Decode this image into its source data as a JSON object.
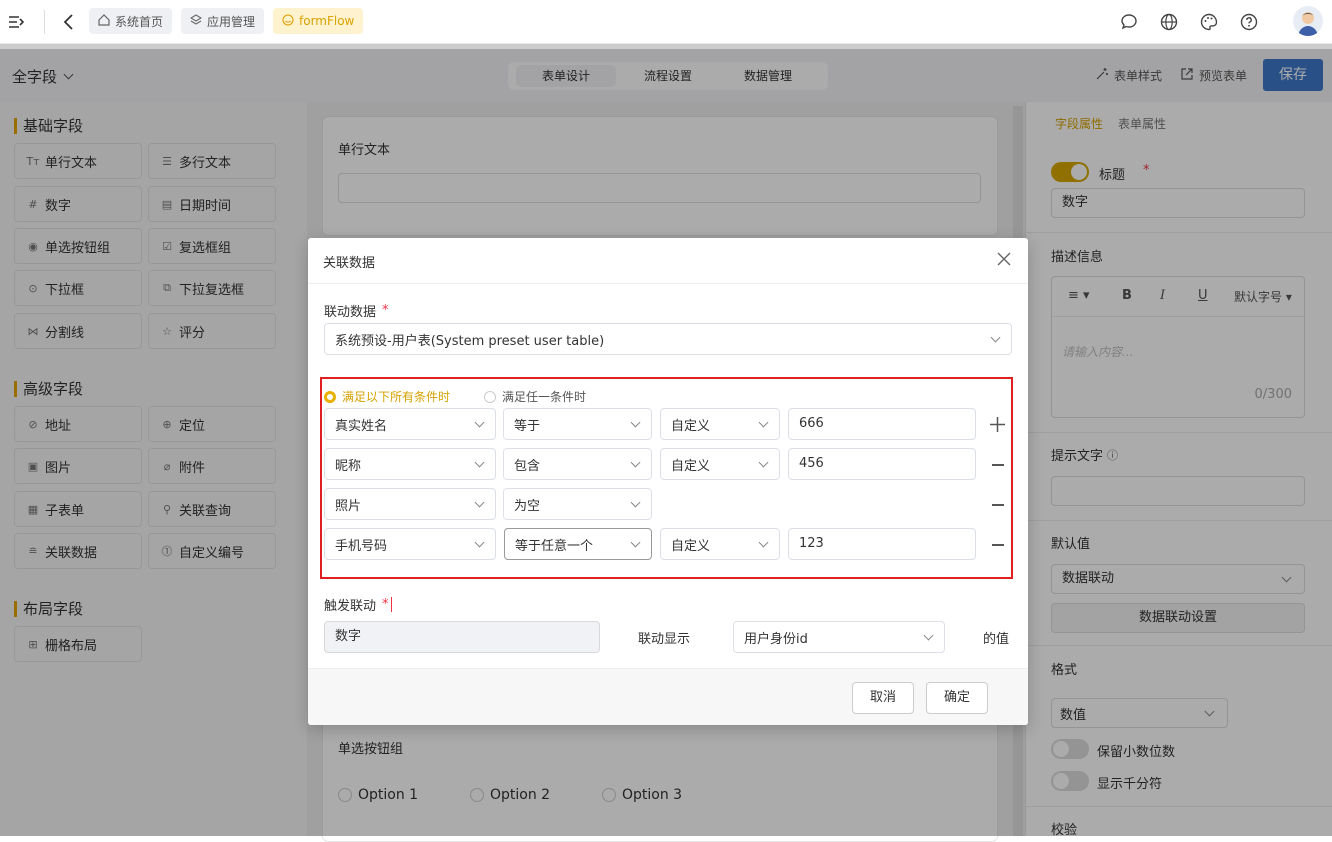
{
  "topbar": {
    "nav": [
      "系统首页",
      "应用管理",
      "formFlow"
    ]
  },
  "toolbar": {
    "field_scope": "全字段",
    "tabs": [
      "表单设计",
      "流程设置",
      "数据管理"
    ],
    "style_label": "表单样式",
    "preview_label": "预览表单",
    "save_label": "保存"
  },
  "left": {
    "basic_title": "基础字段",
    "basic": [
      "单行文本",
      "多行文本",
      "数字",
      "日期时间",
      "单选按钮组",
      "复选框组",
      "下拉框",
      "下拉复选框",
      "分割线",
      "评分"
    ],
    "advanced_title": "高级字段",
    "advanced": [
      "地址",
      "定位",
      "图片",
      "附件",
      "子表单",
      "关联查询",
      "关联数据",
      "自定义编号"
    ],
    "layout_title": "布局字段",
    "layout": [
      "栅格布局"
    ]
  },
  "canvas": {
    "single_text_label": "单行文本",
    "radio_label": "单选按钮组",
    "options": [
      "Option 1",
      "Option 2",
      "Option 3"
    ]
  },
  "right": {
    "tabs": [
      "字段属性",
      "表单属性"
    ],
    "title_label": "标题",
    "title_value": "数字",
    "desc_label": "描述信息",
    "editor_font": "默认字号",
    "editor_placeholder": "请输入内容...",
    "editor_count": "0/300",
    "hint_label": "提示文字",
    "default_label": "默认值",
    "default_value": "数据联动",
    "linkage_btn": "数据联动设置",
    "format_label": "格式",
    "format_value": "数值",
    "decimal_label": "保留小数位数",
    "thousands_label": "显示千分符",
    "validate_label": "校验"
  },
  "modal": {
    "title": "关联数据",
    "link_label": "联动数据",
    "link_value": "系统预设-用户表(System preset user table)",
    "match_all": "满足以下所有条件时",
    "match_any": "满足任一条件时",
    "conditions": [
      {
        "field": "真实姓名",
        "op": "等于",
        "type": "自定义",
        "value": "666"
      },
      {
        "field": "昵称",
        "op": "包含",
        "type": "自定义",
        "value": "456"
      },
      {
        "field": "照片",
        "op": "为空",
        "type": "",
        "value": ""
      },
      {
        "field": "手机号码",
        "op": "等于任意一个",
        "type": "自定义",
        "value": "123"
      }
    ],
    "trigger_label": "触发联动",
    "trigger_value": "数字",
    "show_label": "联动显示",
    "show_value": "用户身份id",
    "suffix": "的值",
    "cancel": "取消",
    "ok": "确定"
  }
}
